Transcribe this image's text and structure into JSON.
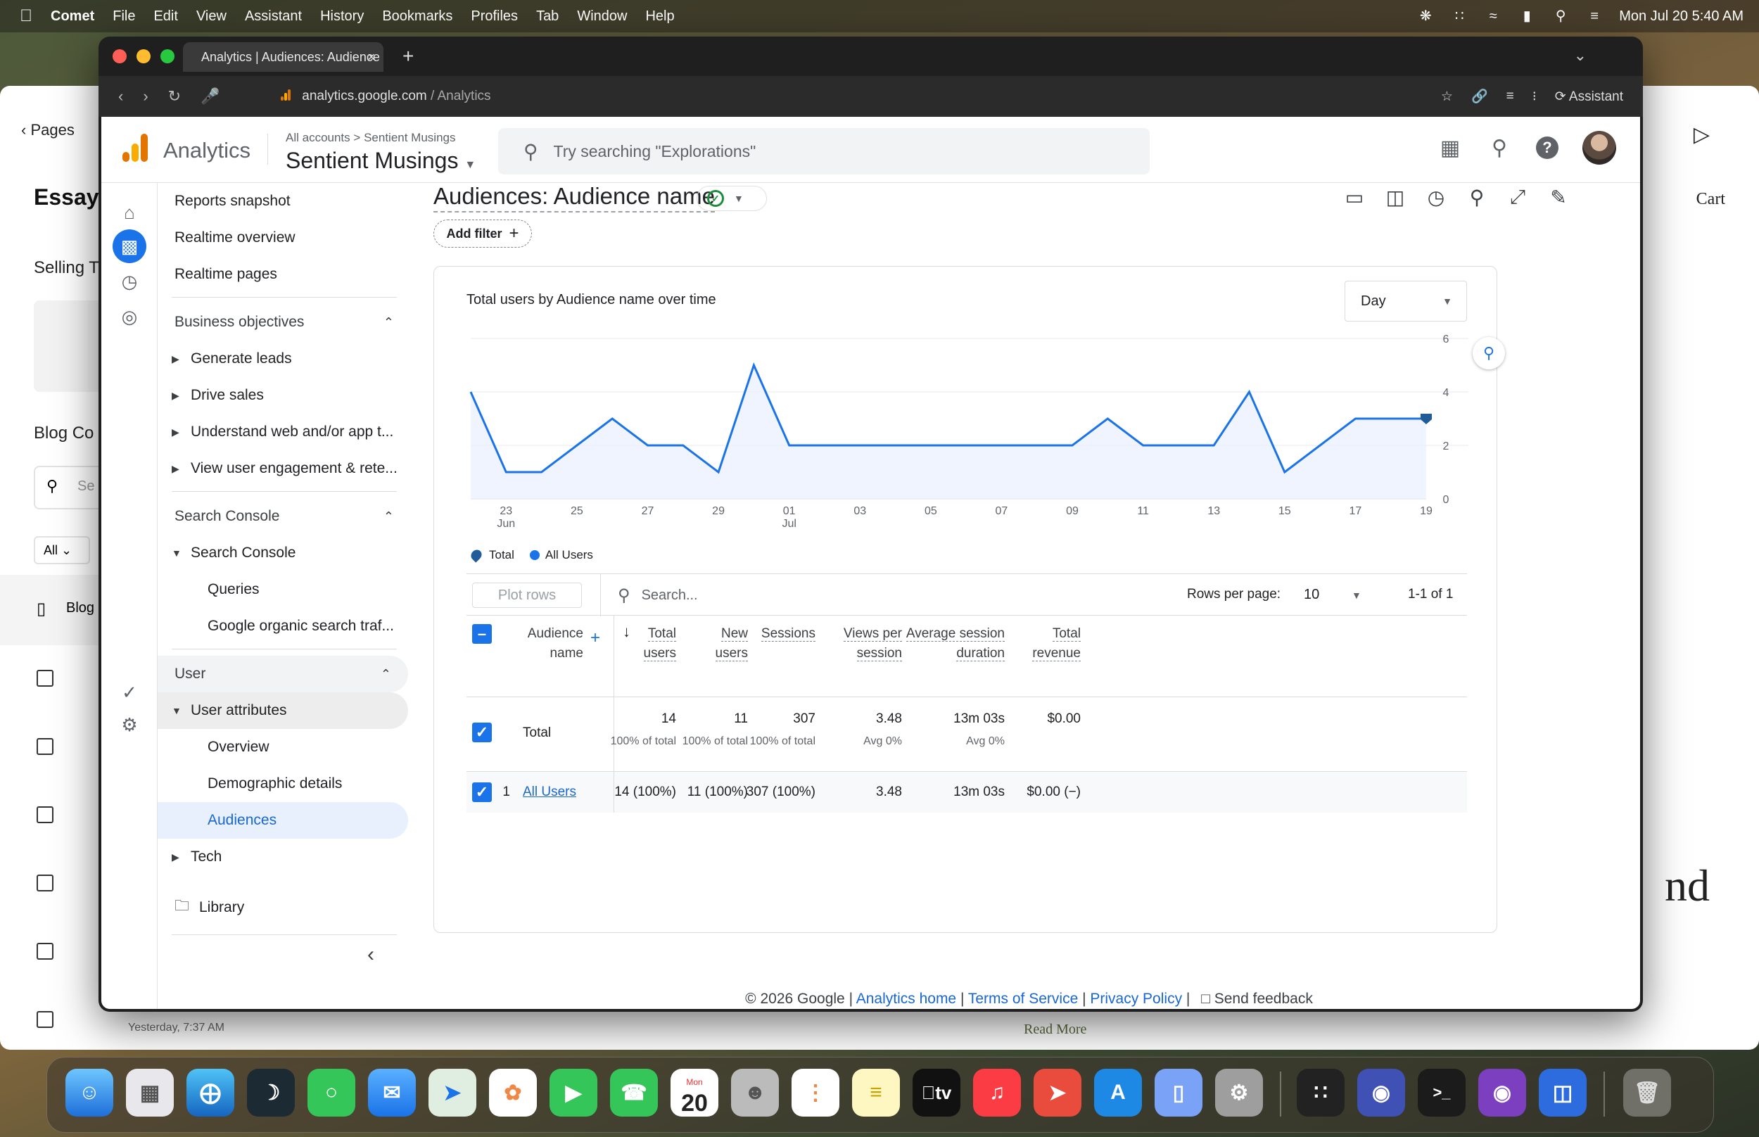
{
  "menubar": {
    "app": "Comet",
    "items": [
      "File",
      "Edit",
      "View",
      "Assistant",
      "History",
      "Bookmarks",
      "Profiles",
      "Tab",
      "Window",
      "Help"
    ],
    "clock": "Mon Jul 20  5:40 AM"
  },
  "background_page": {
    "back": "Pages",
    "essay": "Essay",
    "selling": "Selling T",
    "blog_co": "Blog Co",
    "search_ph": "Se",
    "all": "All",
    "blog": "Blog",
    "cart": "Cart",
    "nd": "nd",
    "read_more": "Read More",
    "yesterday": "Yesterday, 7:37 AM"
  },
  "browser": {
    "tab_title": "Analytics | Audiences: Audience name",
    "url_host": "analytics.google.com",
    "url_path": "/ Analytics",
    "assistant": "Assistant"
  },
  "ga": {
    "product": "Analytics",
    "crumb_all": "All accounts",
    "crumb_sep": ">",
    "crumb_acct": "Sentient Musings",
    "property": "Sentient Musings",
    "search_placeholder": "Try searching \"Explorations\""
  },
  "nav": {
    "reports_snapshot": "Reports snapshot",
    "realtime_overview": "Realtime overview",
    "realtime_pages": "Realtime pages",
    "business_objectives": "Business objectives",
    "generate_leads": "Generate leads",
    "drive_sales": "Drive sales",
    "understand_web": "Understand web and/or app t...",
    "view_engagement": "View user engagement & rete...",
    "search_console_sec": "Search Console",
    "search_console": "Search Console",
    "queries": "Queries",
    "google_organic": "Google organic search traf...",
    "user": "User",
    "user_attributes": "User attributes",
    "overview": "Overview",
    "demographic": "Demographic details",
    "audiences": "Audiences",
    "tech": "Tech",
    "library": "Library"
  },
  "main": {
    "title": "Audiences: Audience name",
    "add_filter": "Add filter",
    "chart_title": "Total users by Audience name over time",
    "granularity": "Day",
    "legend_total": "Total",
    "legend_all": "All Users"
  },
  "chart_data": {
    "type": "area",
    "title": "Total users by Audience name over time",
    "x_tick_labels": [
      "23",
      "25",
      "27",
      "29",
      "01",
      "03",
      "05",
      "07",
      "09",
      "11",
      "13",
      "15",
      "17",
      "19"
    ],
    "x_month_labels": {
      "23": "Jun",
      "01": "Jul"
    },
    "x": [
      "Jun 22",
      "Jun 23",
      "Jun 24",
      "Jun 25",
      "Jun 26",
      "Jun 27",
      "Jun 28",
      "Jun 29",
      "Jun 30",
      "Jul 01",
      "Jul 02",
      "Jul 03",
      "Jul 04",
      "Jul 05",
      "Jul 06",
      "Jul 07",
      "Jul 08",
      "Jul 09",
      "Jul 10",
      "Jul 11",
      "Jul 12",
      "Jul 13",
      "Jul 14",
      "Jul 15",
      "Jul 16",
      "Jul 17",
      "Jul 18",
      "Jul 19"
    ],
    "series": [
      {
        "name": "All Users",
        "values": [
          4,
          1,
          1,
          2,
          3,
          2,
          2,
          1,
          5,
          2,
          2,
          2,
          2,
          2,
          2,
          2,
          2,
          2,
          3,
          2,
          2,
          2,
          4,
          1,
          2,
          3,
          3,
          3
        ]
      }
    ],
    "ylim": [
      0,
      6
    ],
    "yticks": [
      0,
      2,
      4,
      6
    ],
    "axis_side": "right",
    "legend_placement": "bottom-left",
    "colors": {
      "line": "#1a73e8",
      "fill": "#e8f0fe"
    }
  },
  "table": {
    "plot_rows": "Plot rows",
    "search_placeholder": "Search...",
    "rows_per_page_label": "Rows per page:",
    "rows_per_page": "10",
    "pager": "1-1 of 1",
    "headers": {
      "dimension": [
        "Audience",
        "name"
      ],
      "total_users": [
        "Total",
        "users"
      ],
      "new_users": [
        "New",
        "users"
      ],
      "sessions": [
        "Sessions",
        ""
      ],
      "views": [
        "Views per",
        "session"
      ],
      "avg": [
        "Average session",
        "duration"
      ],
      "revenue": [
        "Total",
        "revenue"
      ]
    },
    "total": {
      "label": "Total",
      "total_users": "14",
      "total_users_sub": "100% of total",
      "new_users": "11",
      "new_users_sub": "100% of total",
      "sessions": "307",
      "sessions_sub": "100% of total",
      "views": "3.48",
      "views_sub": "Avg 0%",
      "avg": "13m 03s",
      "avg_sub": "Avg 0%",
      "revenue": "$0.00"
    },
    "rows": [
      {
        "idx": "1",
        "name": "All Users",
        "total_users": "14 (100%)",
        "new_users": "11 (100%)",
        "sessions": "307 (100%)",
        "views": "3.48",
        "avg": "13m 03s",
        "revenue": "$0.00 (−)"
      }
    ]
  },
  "footer": {
    "copyright": "© 2026 Google |",
    "home": "Analytics home",
    "tos": "Terms of Service",
    "privacy": "Privacy Policy",
    "feedback": "Send feedback"
  },
  "dock": {
    "calendar_month": "Mon",
    "calendar_day": "20",
    "tv": "tv",
    "terminal": ">_"
  }
}
